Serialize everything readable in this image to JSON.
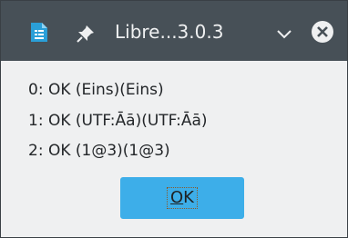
{
  "window": {
    "title": "Libre...3.0.3"
  },
  "titlebar": {
    "app_icon": "libreoffice-document-icon",
    "pin_icon": "pin-icon",
    "menu_icon": "chevron-down-icon",
    "close_icon": "close-icon"
  },
  "messages": [
    "0: OK (Eins)(Eins)",
    "1: OK (UTF:Āā)(UTF:Āā)",
    "2: OK (1@3)(1@3)"
  ],
  "buttons": {
    "ok_label_first": "O",
    "ok_label_rest": "K"
  },
  "colors": {
    "titlebar": "#475057",
    "accent": "#3daee9",
    "background": "#eff0f1"
  }
}
